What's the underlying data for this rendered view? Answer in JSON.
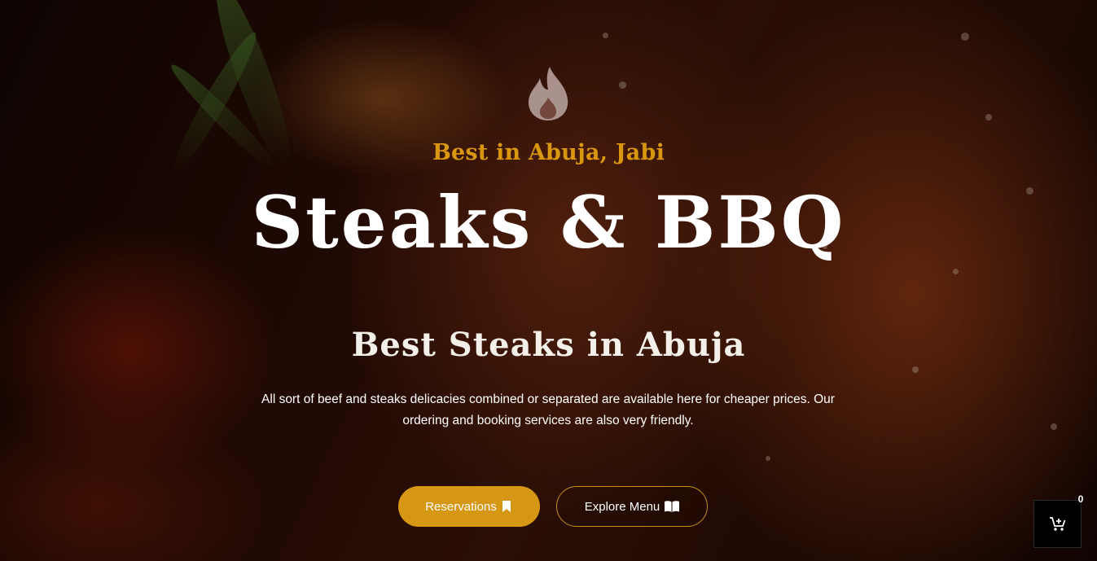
{
  "hero": {
    "tagline": "Best in Abuja, Jabi",
    "title": "Steaks & BBQ",
    "subtitle": "Best Steaks in Abuja",
    "description": "All sort of beef and steaks delicacies combined or separated are available here for cheaper prices. Our ordering and booking services are also very friendly.",
    "icon": "flame-icon"
  },
  "actions": {
    "reservations_label": "Reservations",
    "reservations_icon": "bookmark-icon",
    "explore_menu_label": "Explore Menu",
    "explore_menu_icon": "open-book-icon"
  },
  "cart": {
    "count": "0",
    "icon": "cart-plus-icon"
  },
  "colors": {
    "accent": "#d69714",
    "tagline": "#d9970f",
    "text": "#ffffff",
    "cart_bg": "#000000"
  }
}
